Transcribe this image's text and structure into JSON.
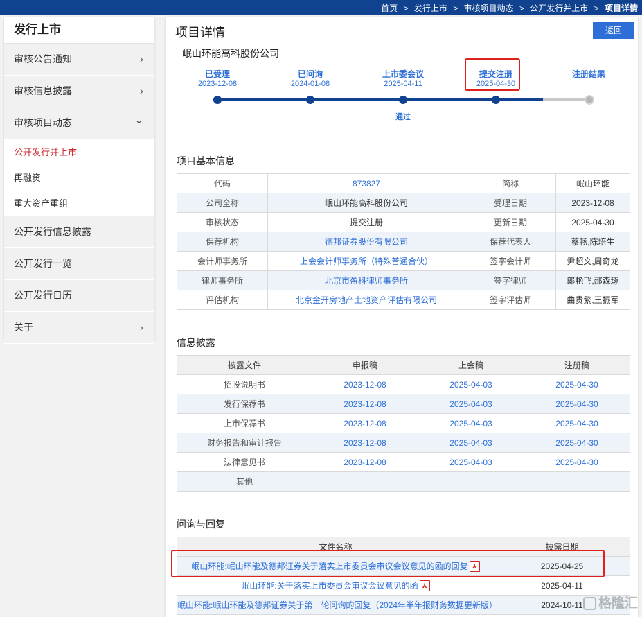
{
  "breadcrumb": [
    "首页",
    "发行上市",
    "审核项目动态",
    "公开发行并上市",
    "项目详情"
  ],
  "breadcrumb_sep": ">",
  "sidebar": {
    "title": "发行上市",
    "items": [
      {
        "label": "审核公告通知",
        "arrow": "›"
      },
      {
        "label": "审核信息披露",
        "arrow": "›"
      },
      {
        "label": "审核项目动态",
        "arrow": "⌄"
      }
    ],
    "subitems": [
      "公开发行并上市",
      "再融资",
      "重大资产重组"
    ],
    "items2": [
      {
        "label": "公开发行信息披露",
        "arrow": ""
      },
      {
        "label": "公开发行一览",
        "arrow": ""
      },
      {
        "label": "公开发行日历",
        "arrow": ""
      },
      {
        "label": "关于",
        "arrow": "›"
      }
    ]
  },
  "main": {
    "title": "项目详情",
    "back_label": "返回",
    "company": "岷山环能高科股份公司",
    "steps": [
      {
        "label": "已受理",
        "date": "2023-12-08"
      },
      {
        "label": "已问询",
        "date": "2024-01-08"
      },
      {
        "label": "上市委会议",
        "date": "2025-04-11",
        "note": "通过"
      },
      {
        "label": "提交注册",
        "date": "2025-04-30"
      },
      {
        "label": "注册结果",
        "date": ""
      }
    ],
    "colors": {
      "accent": "#2d6fd6",
      "nav": "#10428f",
      "highlight": "#e0201b",
      "active_menu": "#c8272c"
    }
  },
  "basic": {
    "title": "项目基本信息",
    "rows": [
      [
        "代码",
        "873827",
        "简称",
        "岷山环能"
      ],
      [
        "公司全称",
        "岷山环能高科股份公司",
        "受理日期",
        "2023-12-08"
      ],
      [
        "审核状态",
        "提交注册",
        "更新日期",
        "2025-04-30"
      ],
      [
        "保荐机构",
        "德邦证券股份有限公司",
        "保荐代表人",
        "蔡畅,陈培生"
      ],
      [
        "会计师事务所",
        "上会会计师事务所（特殊普通合伙）",
        "签字会计师",
        "尹超文,周奇龙"
      ],
      [
        "律师事务所",
        "北京市盈科律师事务所",
        "签字律师",
        "郎艳飞,邵森琢"
      ],
      [
        "评估机构",
        "北京金开房地产土地资产评估有限公司",
        "签字评估师",
        "曲贵繁,王振军"
      ]
    ]
  },
  "disclosure": {
    "title": "信息披露",
    "headers": [
      "披露文件",
      "申报稿",
      "上会稿",
      "注册稿"
    ],
    "rows": [
      [
        "招股说明书",
        "2023-12-08",
        "2025-04-03",
        "2025-04-30"
      ],
      [
        "发行保荐书",
        "2023-12-08",
        "2025-04-03",
        "2025-04-30"
      ],
      [
        "上市保荐书",
        "2023-12-08",
        "2025-04-03",
        "2025-04-30"
      ],
      [
        "财务报告和审计报告",
        "2023-12-08",
        "2025-04-03",
        "2025-04-30"
      ],
      [
        "法律意见书",
        "2023-12-08",
        "2025-04-03",
        "2025-04-30"
      ],
      [
        "其他",
        "",
        "",
        ""
      ]
    ]
  },
  "qa": {
    "title": "问询与回复",
    "headers": [
      "文件名称",
      "披露日期"
    ],
    "pdf_icon": "pdf-icon",
    "pdf_glyph": "⅄",
    "rows": [
      [
        "岷山环能:岷山环能及德邦证券关于落实上市委员会审议会议意见的函的回复",
        "2025-04-25"
      ],
      [
        "岷山环能:关于落实上市委员会审议会议意见的函",
        "2025-04-11"
      ],
      [
        "岷山环能:岷山环能及德邦证券关于第一轮问询的回复（2024年半年报财务数据更新版）",
        "2024-10-11"
      ]
    ]
  },
  "watermark": "格隆汇"
}
